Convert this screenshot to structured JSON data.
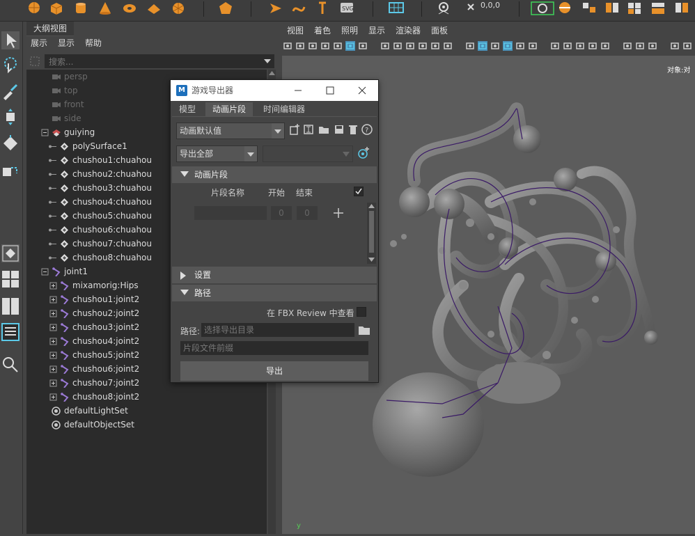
{
  "shelf": {
    "icons": [
      "sphere-icon",
      "cube-icon",
      "cylinder-icon",
      "cone-icon",
      "torus-icon",
      "plane-icon",
      "disc-icon",
      "polygon-icon",
      "light-icon",
      "curve-icon",
      "joint-icon",
      "svg-icon",
      "grid-icon",
      "camera-icon",
      "coord-icon"
    ],
    "coord_text": "0,0,0"
  },
  "toolbox": {
    "icons": [
      "select-tool-icon",
      "lasso-tool-icon",
      "paint-tool-icon",
      "move-tool-icon",
      "rotate-tool-icon",
      "scale-tool-icon",
      "layout-single-icon",
      "layout-four-icon",
      "layout-two-icon",
      "outliner-layout-icon",
      "search-zoom-icon"
    ]
  },
  "outliner": {
    "tab": "大纲视图",
    "menu": [
      "展示",
      "显示",
      "帮助"
    ],
    "search_placeholder": "搜索...",
    "items": [
      {
        "label": "persp",
        "type": "camera",
        "dim": true,
        "indent": 0
      },
      {
        "label": "top",
        "type": "camera",
        "dim": true,
        "indent": 0
      },
      {
        "label": "front",
        "type": "camera",
        "dim": true,
        "indent": 0
      },
      {
        "label": "side",
        "type": "camera",
        "dim": true,
        "indent": 0
      },
      {
        "label": "guiying",
        "type": "group",
        "dim": false,
        "indent": 0,
        "expand": "minus"
      },
      {
        "label": "polySurface1",
        "type": "mesh",
        "dim": false,
        "indent": 1
      },
      {
        "label": "chushou1:chuahou",
        "type": "mesh",
        "dim": false,
        "indent": 1
      },
      {
        "label": "chushou2:chuahou",
        "type": "mesh",
        "dim": false,
        "indent": 1
      },
      {
        "label": "chushou3:chuahou",
        "type": "mesh",
        "dim": false,
        "indent": 1
      },
      {
        "label": "chushou4:chuahou",
        "type": "mesh",
        "dim": false,
        "indent": 1
      },
      {
        "label": "chushou5:chuahou",
        "type": "mesh",
        "dim": false,
        "indent": 1
      },
      {
        "label": "chushou6:chuahou",
        "type": "mesh",
        "dim": false,
        "indent": 1
      },
      {
        "label": "chushou7:chuahou",
        "type": "mesh",
        "dim": false,
        "indent": 1
      },
      {
        "label": "chushou8:chuahou",
        "type": "mesh",
        "dim": false,
        "indent": 1
      },
      {
        "label": "joint1",
        "type": "joint",
        "dim": false,
        "indent": 0,
        "expand": "minus"
      },
      {
        "label": "mixamorig:Hips",
        "type": "joint",
        "dim": false,
        "indent": 1,
        "expand": "plus"
      },
      {
        "label": "chushou1:joint2",
        "type": "joint",
        "dim": false,
        "indent": 1,
        "expand": "plus"
      },
      {
        "label": "chushou2:joint2",
        "type": "joint",
        "dim": false,
        "indent": 1,
        "expand": "plus"
      },
      {
        "label": "chushou3:joint2",
        "type": "joint",
        "dim": false,
        "indent": 1,
        "expand": "plus"
      },
      {
        "label": "chushou4:joint2",
        "type": "joint",
        "dim": false,
        "indent": 1,
        "expand": "plus"
      },
      {
        "label": "chushou5:joint2",
        "type": "joint",
        "dim": false,
        "indent": 1,
        "expand": "plus"
      },
      {
        "label": "chushou6:joint2",
        "type": "joint",
        "dim": false,
        "indent": 1,
        "expand": "plus"
      },
      {
        "label": "chushou7:joint2",
        "type": "joint",
        "dim": false,
        "indent": 1,
        "expand": "plus"
      },
      {
        "label": "chushou8:joint2",
        "type": "joint",
        "dim": false,
        "indent": 1,
        "expand": "plus"
      },
      {
        "label": "defaultLightSet",
        "type": "set",
        "dim": false,
        "indent": 0
      },
      {
        "label": "defaultObjectSet",
        "type": "set",
        "dim": false,
        "indent": 0
      }
    ]
  },
  "viewport": {
    "menu": [
      "视图",
      "着色",
      "照明",
      "显示",
      "渲染器",
      "面板"
    ],
    "object_label": "对象:对",
    "axis_label": "y"
  },
  "dialog": {
    "title": "游戏导出器",
    "app_badge": "M",
    "tabs": [
      "模型",
      "动画片段",
      "时间编辑器"
    ],
    "active_tab": 1,
    "preset_value": "动画默认值",
    "export_mode": "导出全部",
    "section_clips": "动画片段",
    "col_name": "片段名称",
    "col_start": "开始",
    "col_end": "结束",
    "start_value": "0",
    "end_value": "0",
    "section_settings": "设置",
    "section_path": "路径",
    "fbx_review_label": "在 FBX Review 中查看",
    "path_label": "路径:",
    "path_placeholder": "选择导出目录",
    "prefix_placeholder": "片段文件前缀",
    "export_button": "导出"
  },
  "colors": {
    "maya_bg": "#444444",
    "field_bg": "#2b2b2b",
    "viewport_bg": "#5c5c5c",
    "accent_orange": "#f0a030",
    "highlight_cyan": "#5cc9e8",
    "skeleton_purple": "#3a1a66"
  }
}
